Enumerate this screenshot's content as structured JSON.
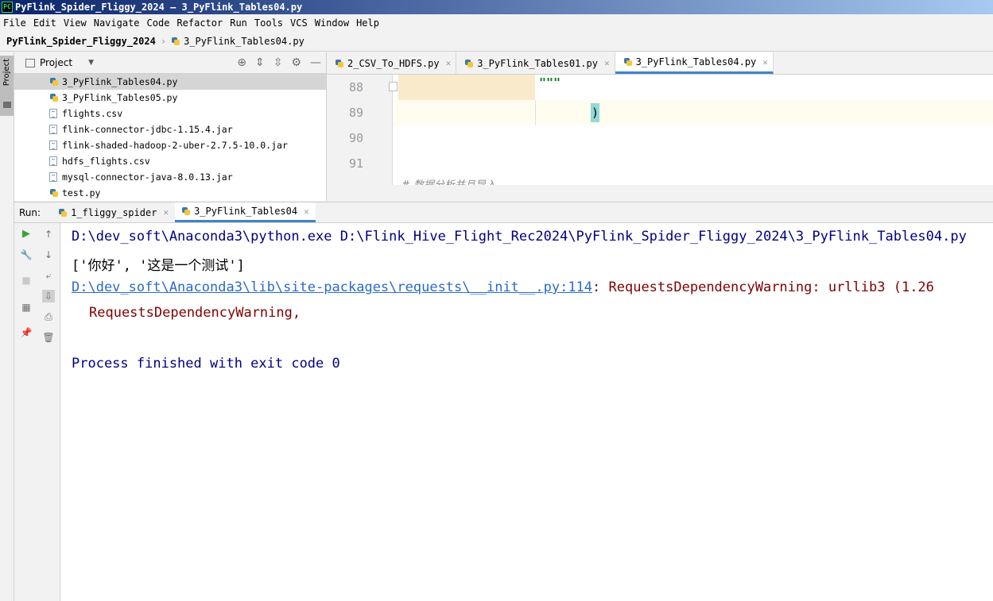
{
  "window": {
    "title": "PyFlink_Spider_Fliggy_2024 – 3_PyFlink_Tables04.py"
  },
  "menu": [
    "File",
    "Edit",
    "View",
    "Navigate",
    "Code",
    "Refactor",
    "Run",
    "Tools",
    "VCS",
    "Window",
    "Help"
  ],
  "breadcrumb": {
    "project": "PyFlink_Spider_Fliggy_2024",
    "file": "3_PyFlink_Tables04.py"
  },
  "left_stripe": {
    "project_label": "Project"
  },
  "project_panel": {
    "title": "Project",
    "files": [
      {
        "name": "3_PyFlink_Tables04.py",
        "type": "python",
        "selected": true
      },
      {
        "name": "3_PyFlink_Tables05.py",
        "type": "python",
        "selected": false
      },
      {
        "name": "flights.csv",
        "type": "text",
        "selected": false
      },
      {
        "name": "flink-connector-jdbc-1.15.4.jar",
        "type": "jar",
        "selected": false
      },
      {
        "name": "flink-shaded-hadoop-2-uber-2.7.5-10.0.jar",
        "type": "jar",
        "selected": false
      },
      {
        "name": "hdfs_flights.csv",
        "type": "text",
        "selected": false
      },
      {
        "name": "mysql-connector-java-8.0.13.jar",
        "type": "jar",
        "selected": false
      },
      {
        "name": "test.py",
        "type": "python",
        "selected": false
      }
    ]
  },
  "editor": {
    "tabs": [
      {
        "label": "2_CSV_To_HDFS.py",
        "active": false
      },
      {
        "label": "3_PyFlink_Tables01.py",
        "active": false
      },
      {
        "label": "3_PyFlink_Tables04.py",
        "active": true
      }
    ],
    "line_numbers": [
      "88",
      "89",
      "90",
      "91"
    ],
    "line88": "\"\"\"",
    "line89": ")",
    "cut_off_comment": "# 数据分析并且导入"
  },
  "run_panel": {
    "label": "Run:",
    "tabs": [
      {
        "label": "1_fliggy_spider",
        "active": false
      },
      {
        "label": "3_PyFlink_Tables04",
        "active": true
      }
    ],
    "console": {
      "command": "D:\\dev_soft\\Anaconda3\\python.exe D:\\Flink_Hive_Flight_Rec2024\\PyFlink_Spider_Fliggy_2024\\3_PyFlink_Tables04.py",
      "output": "['你好', '这是一个测试']",
      "warning_link": "D:\\dev_soft\\Anaconda3\\lib\\site-packages\\requests\\__init__.py:114",
      "warning_text": ": RequestsDependencyWarning: urllib3 (1.26",
      "warning_cont": "RequestsDependencyWarning,",
      "exit": "Process finished with exit code 0"
    }
  }
}
